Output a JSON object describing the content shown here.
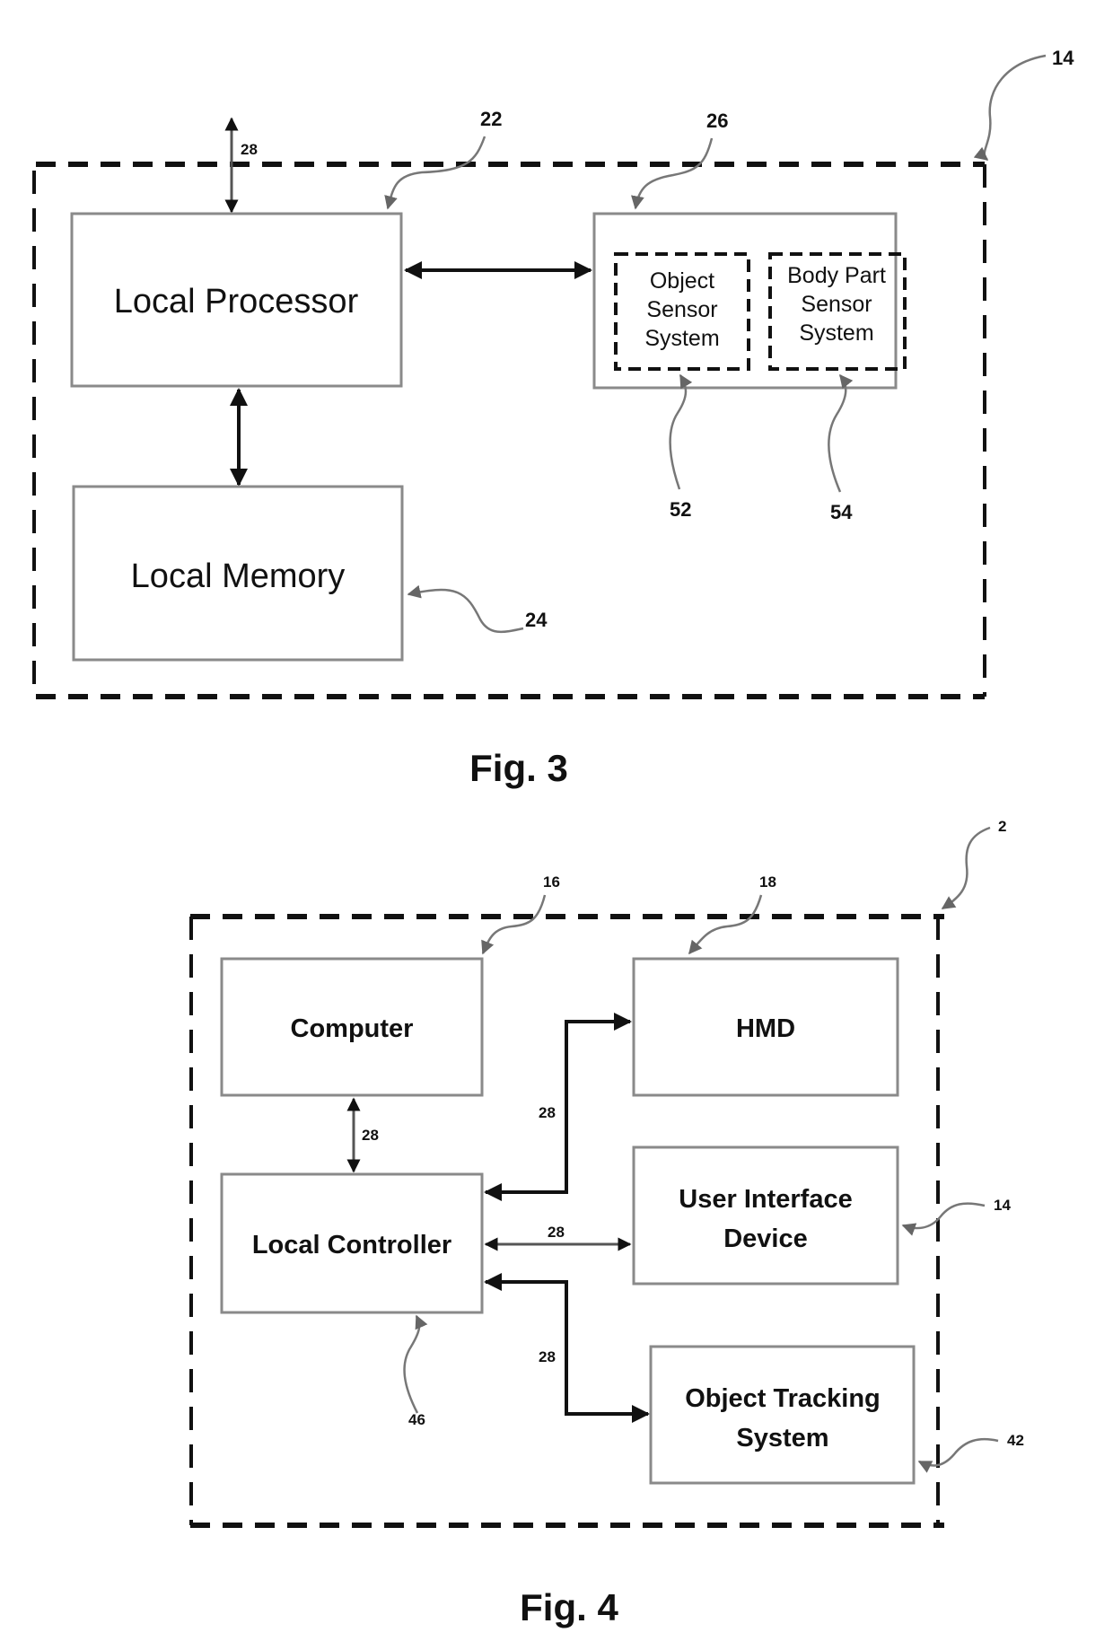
{
  "figures": [
    {
      "caption": "Fig. 3",
      "container_ref": "14",
      "blocks": {
        "local_processor": {
          "label": "Local Processor",
          "ref": "22"
        },
        "local_memory": {
          "label": "Local Memory",
          "ref": "24"
        },
        "sensor_block": {
          "ref": "26"
        },
        "object_sensor": {
          "lines": [
            "Object",
            "Sensor",
            "System"
          ],
          "ref": "52"
        },
        "body_part_sensor": {
          "lines": [
            "Body Part",
            "Sensor",
            "System"
          ],
          "ref": "54"
        }
      },
      "connections": {
        "external_link_ref": "28"
      }
    },
    {
      "caption": "Fig. 4",
      "container_ref": "2",
      "blocks": {
        "computer": {
          "label": "Computer",
          "ref": "16"
        },
        "hmd": {
          "label": "HMD",
          "ref": "18"
        },
        "local_controller": {
          "label": "Local Controller",
          "ref": "46"
        },
        "user_interface_device": {
          "lines": [
            "User Interface",
            "Device"
          ],
          "ref": "14"
        },
        "object_tracking_system": {
          "lines": [
            "Object Tracking",
            "System"
          ],
          "ref": "42"
        }
      },
      "connections": {
        "computer_controller_ref": "28",
        "controller_hmd_ref": "28",
        "controller_uid_ref": "28",
        "controller_ots_ref": "28"
      }
    }
  ]
}
